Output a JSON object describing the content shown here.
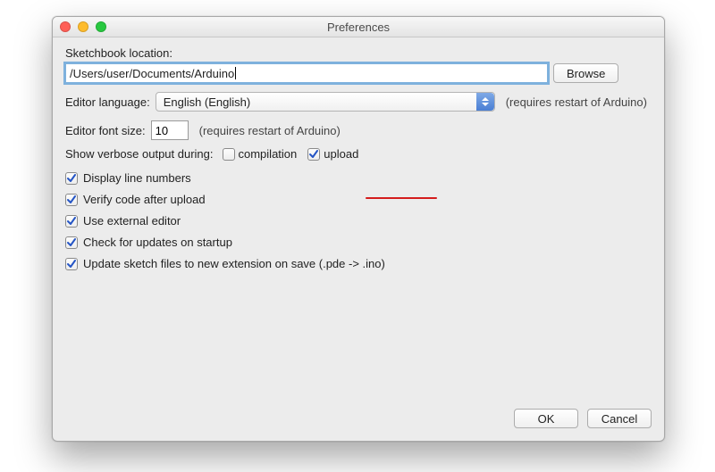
{
  "window": {
    "title": "Preferences"
  },
  "sketchbook": {
    "label": "Sketchbook location:",
    "value": "/Users/user/Documents/Arduino",
    "browse": "Browse"
  },
  "language": {
    "label": "Editor language:",
    "selected": "English (English)",
    "note": "(requires restart of Arduino)"
  },
  "fontsize": {
    "label": "Editor font size:",
    "value": "10",
    "note": "(requires restart of Arduino)"
  },
  "verbose": {
    "label": "Show verbose output during:",
    "compilation_label": "compilation",
    "compilation_checked": false,
    "upload_label": "upload",
    "upload_checked": true
  },
  "options": [
    {
      "label": "Display line numbers",
      "checked": true
    },
    {
      "label": "Verify code after upload",
      "checked": true
    },
    {
      "label": "Use external editor",
      "checked": true
    },
    {
      "label": "Check for updates on startup",
      "checked": true
    },
    {
      "label": "Update sketch files to new extension on save (.pde -> .ino)",
      "checked": true
    }
  ],
  "buttons": {
    "ok": "OK",
    "cancel": "Cancel"
  }
}
